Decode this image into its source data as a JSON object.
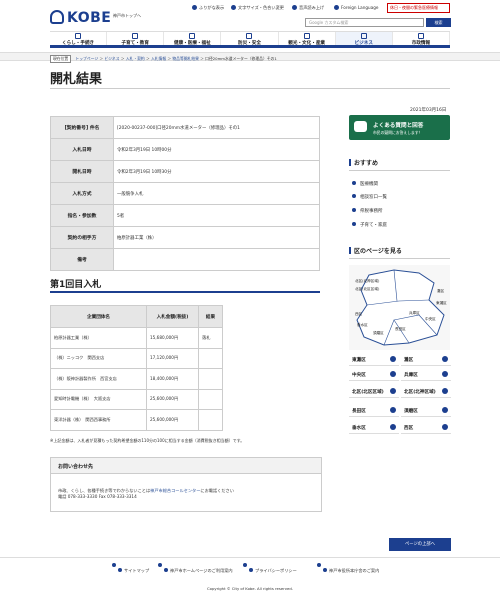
{
  "header": {
    "logo_text": "KOBE",
    "top_link": "神戸市トップへ",
    "util": [
      "ふりがな表示",
      "文字サイズ・色合い変更",
      "音声読み上げ",
      "Foreign Language"
    ],
    "alert_button": "休日・夜間の緊急医療情報",
    "search_placeholder": "Google カスタム検索",
    "search_button": "検索"
  },
  "nav": [
    "くらし・手続き",
    "子育て・教育",
    "健康・医療・福祉",
    "防災・安全",
    "観光・文化・産業",
    "ビジネス",
    "市政情報"
  ],
  "breadcrumb": {
    "here": "現在位置",
    "items": [
      "トップページ",
      "ビジネス",
      "入札・契約",
      "入札情報",
      "物品等開札結果",
      "口径20mm水道メーター（修理品）その1"
    ]
  },
  "page": {
    "title": "開札結果",
    "date": "2021年03月16日"
  },
  "info_table": [
    {
      "label": "[契約番号] 件名",
      "value": "[2020-00237-000]口径20mm水道メーター（修理品）その1"
    },
    {
      "label": "入札日時",
      "value": "令和2年3月19日 10時00分"
    },
    {
      "label": "開札日時",
      "value": "令和2年3月19日 10時30分"
    },
    {
      "label": "入札方式",
      "value": "一般競争入札"
    },
    {
      "label": "指名・参加数",
      "value": "5者"
    },
    {
      "label": "契約の相手方",
      "value": "柏原計器工業（株）"
    },
    {
      "label": "備考",
      "value": ""
    }
  ],
  "round": {
    "title": "第1回目入札",
    "headers": [
      "企業団体名",
      "入札金額(税抜)",
      "結果"
    ],
    "rows": [
      {
        "name": "柏原計器工業（株）",
        "amount": "15,680,000円",
        "result": "落札"
      },
      {
        "name": "（株）ニッコク　関西支店",
        "amount": "17,120,000円",
        "result": ""
      },
      {
        "name": "（株）阪神計器製作所　西宮支店",
        "amount": "18,400,000円",
        "result": ""
      },
      {
        "name": "愛知時計電機（株）　大阪支店",
        "amount": "25,600,000円",
        "result": ""
      },
      {
        "name": "東洋計器（株）　関西西事務所",
        "amount": "25,600,000円",
        "result": ""
      }
    ]
  },
  "note": "※上記金額は、入札者が見積もった契約希望金額の110分の100に相当する金額（消費税抜き相当額）です。",
  "contact": {
    "title": "お問い合わせ先",
    "line1_pre": "市政、くらし、各種手続き等でわからないことは",
    "line1_link": "神戸市総合コールセンター",
    "line1_post": "にお電話ください",
    "line2": "電話 078-333-3330 Fax 078-333-3314"
  },
  "side": {
    "faq_title": "よくある質問と回答",
    "faq_sub": "市民の疑問にお答えします！",
    "recommend_title": "おすすめ",
    "recommend": [
      "医療機関",
      "相談窓口一覧",
      "県税事務所",
      "子育て・家庭"
    ],
    "wards_title": "区のページを見る",
    "map_labels": [
      "北区(北神区域)",
      "北区(北区区域)",
      "西区",
      "垂水区",
      "須磨区",
      "長田区",
      "兵庫区",
      "中央区",
      "灘区",
      "東灘区"
    ],
    "wards": [
      "東灘区",
      "灘区",
      "中央区",
      "兵庫区",
      "北区(北区区域)",
      "北区(北神区域)",
      "長田区",
      "須磨区",
      "垂水区",
      "西区"
    ]
  },
  "to_top": "ページの上部へ",
  "footer": {
    "links": [
      "サイトマップ",
      "神戸市ホームページのご利用案内",
      "プライバシーポリシー",
      "神戸市役所本庁舎のご案内"
    ],
    "copyright": "Copyright © City of Kobe. All rights reserved."
  }
}
